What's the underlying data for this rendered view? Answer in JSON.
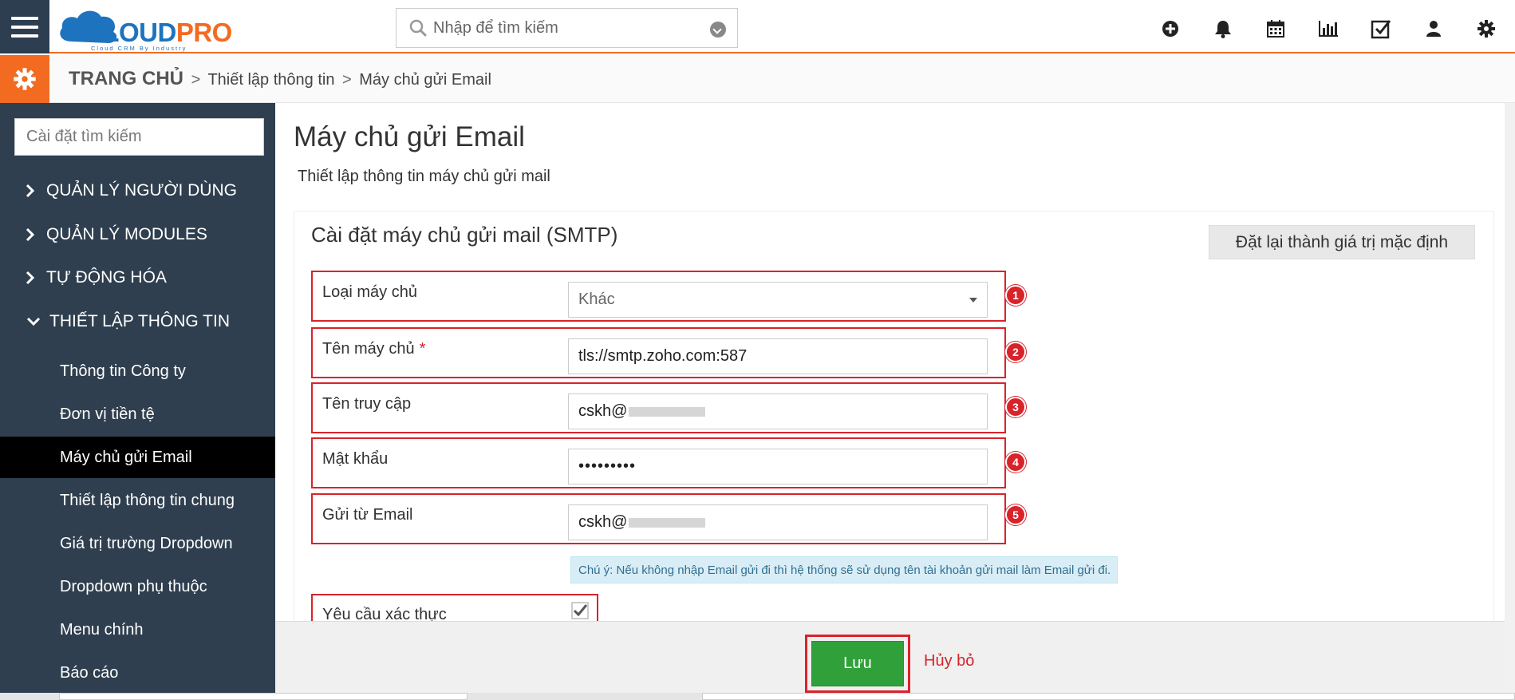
{
  "header": {
    "logo_main": "CLOUD",
    "logo_accent": "PRO",
    "logo_tagline": "Cloud CRM By Industry",
    "search_placeholder": "Nhập để tìm kiếm",
    "tools": [
      "plus-circle-icon",
      "bell-icon",
      "calendar-icon",
      "bar-chart-icon",
      "checkbox-icon",
      "user-icon",
      "gear-icon"
    ]
  },
  "breadcrumb": {
    "home": "TRANG CHỦ",
    "sep": ">",
    "level1": "Thiết lập thông tin",
    "level2": "Máy chủ gửi Email"
  },
  "sidebar": {
    "search_placeholder": "Cài đặt tìm kiếm",
    "sections": [
      {
        "label": "QUẢN LÝ NGƯỜI DÙNG",
        "expanded": false
      },
      {
        "label": "QUẢN LÝ MODULES",
        "expanded": false
      },
      {
        "label": "TỰ ĐỘNG HÓA",
        "expanded": false
      },
      {
        "label": "THIẾT LẬP THÔNG TIN",
        "expanded": true
      }
    ],
    "items": [
      {
        "label": "Thông tin Công ty"
      },
      {
        "label": "Đơn vị tiền tệ"
      },
      {
        "label": "Máy chủ gửi Email",
        "active": true
      },
      {
        "label": "Thiết lập thông tin chung"
      },
      {
        "label": "Giá trị trường Dropdown"
      },
      {
        "label": "Dropdown phụ thuộc"
      },
      {
        "label": "Menu chính"
      },
      {
        "label": "Báo cáo"
      }
    ]
  },
  "main": {
    "title": "Máy chủ gửi Email",
    "subtitle": "Thiết lập thông tin máy chủ gửi mail",
    "panel_title": "Cài đặt máy chủ gửi mail (SMTP)",
    "reset_label": "Đặt lại thành giá trị mặc định",
    "fields": [
      {
        "label": "Loại máy chủ",
        "value": "Khác",
        "badge": "1"
      },
      {
        "label": "Tên máy chủ",
        "required": "*",
        "value": "tls://smtp.zoho.com:587",
        "badge": "2"
      },
      {
        "label": "Tên truy cập",
        "value": "cskh@",
        "badge": "3"
      },
      {
        "label": "Mật khẩu",
        "value": "•••••••••",
        "badge": "4"
      },
      {
        "label": "Gửi từ Email",
        "value": "cskh@",
        "badge": "5"
      }
    ],
    "note": "Chú ý: Nếu không nhập Email gửi đi thì hệ thống sẽ sử dụng tên tài khoản gửi mail làm Email gửi đi.",
    "auth_label": "Yêu cầu xác thực",
    "auth_checked": true
  },
  "footer": {
    "save_label": "Lưu",
    "cancel_label": "Hủy bỏ"
  },
  "colors": {
    "accent": "#f26b21",
    "brand_blue": "#1e73be",
    "sidebar_bg": "#2f3f4f",
    "highlight_red": "#d9232a",
    "save_green": "#30a13a"
  }
}
